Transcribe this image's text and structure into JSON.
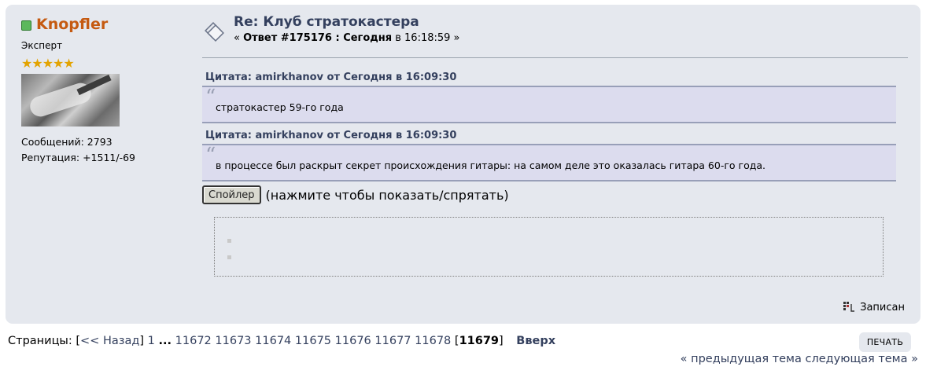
{
  "poster": {
    "name": "Knopfler",
    "rank": "Эксперт",
    "stars": [
      "★",
      "★",
      "★",
      "★",
      "★"
    ],
    "messages": "Сообщений: 2793",
    "reputation": "Репутация: +1511/-69",
    "online_color": "#5cb85c"
  },
  "post": {
    "title": "Re: Клуб стратокастера",
    "meta_prefix": "« ",
    "meta_bold": "Ответ #175176 : Сегодня",
    "meta_time": " в 16:18:59 »"
  },
  "quotes": [
    {
      "header": "Цитата: amirkhanov от Сегодня в 16:09:30",
      "text": "стратокастер 59-го года"
    },
    {
      "header": "Цитата: amirkhanov от Сегодня в 16:09:30",
      "text": "в процессе был раскрыт секрет происхождения гитары: на самом деле это оказалась гитара 60-го года."
    }
  ],
  "spoiler": {
    "button": "Спойлер",
    "hint": "(нажмите чтобы показать/спрятать)"
  },
  "saved_label": "Записан",
  "pagination": {
    "label": "Страницы: [",
    "back": "<< Назад",
    "first": "1",
    "ellipsis": "...",
    "pages": [
      "11672",
      "11673",
      "11674",
      "11675",
      "11676",
      "11677",
      "11678"
    ],
    "current": "11679",
    "up": "Вверх"
  },
  "print_label": "ПЕЧАТЬ",
  "topic_nav": {
    "prev": "« предыдущая тема",
    "next": "следующая тема »"
  },
  "colors": {
    "post_bg": "#e5e8ee",
    "quote_bg": "#dcdcee",
    "name": "#c55a11",
    "link": "#34405e"
  }
}
